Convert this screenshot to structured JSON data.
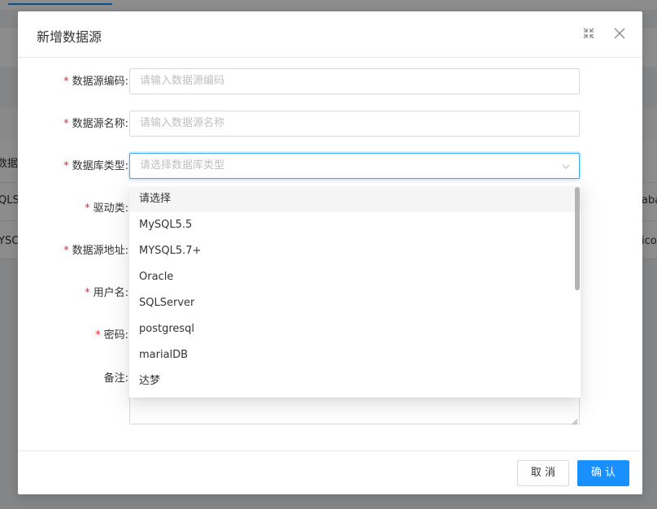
{
  "background": {
    "row1_left": "数据库",
    "row2_left": "QLS",
    "row3_left": "YSC",
    "row2_right": "aba",
    "row3_right": "ico"
  },
  "dialog": {
    "title": "新增数据源"
  },
  "form": {
    "code": {
      "label": "数据源编码:",
      "placeholder": "请输入数据源编码",
      "required": true
    },
    "name": {
      "label": "数据源名称:",
      "placeholder": "请输入数据源名称",
      "required": true
    },
    "db_type": {
      "label": "数据库类型:",
      "placeholder": "请选择数据库类型",
      "required": true
    },
    "driver": {
      "label": "驱动类:",
      "required": true
    },
    "url": {
      "label": "数据源地址:",
      "required": true
    },
    "username": {
      "label": "用户名:",
      "required": true
    },
    "password": {
      "label": "密码:",
      "required": true
    },
    "remark": {
      "label": "备注:",
      "required": false
    }
  },
  "dropdown": {
    "options": [
      "请选择",
      "MySQL5.5",
      "MYSQL5.7+",
      "Oracle",
      "SQLServer",
      "postgresql",
      "marialDB",
      "达梦"
    ]
  },
  "footer": {
    "cancel_label": "取 消",
    "ok_label": "确 认"
  },
  "colors": {
    "primary": "#1890ff",
    "required": "#f5222d",
    "focus_border": "#40a9ff"
  }
}
